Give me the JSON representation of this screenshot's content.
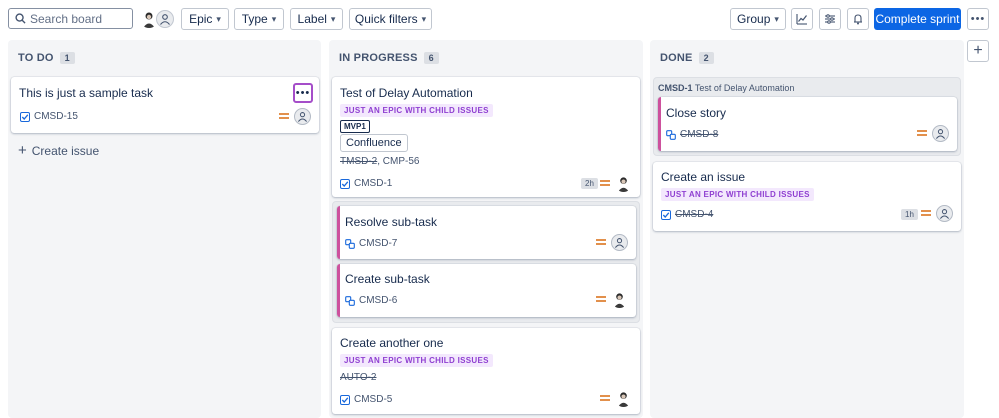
{
  "toolbar": {
    "search_placeholder": "Search board",
    "filters": [
      {
        "label": "Epic"
      },
      {
        "label": "Type"
      },
      {
        "label": "Label"
      },
      {
        "label": "Quick filters"
      }
    ],
    "group_label": "Group",
    "complete_sprint_label": "Complete sprint"
  },
  "columns": [
    {
      "name": "TO DO",
      "count": "1",
      "create_label": "Create issue",
      "cards": [
        {
          "title": "This is just a sample task",
          "key": "CMSD-15"
        }
      ]
    },
    {
      "name": "IN PROGRESS",
      "count": "6",
      "cards": [
        {
          "title": "Test of Delay Automation",
          "epic": "JUST AN EPIC WITH CHILD ISSUES",
          "label_mvp": "MVP1",
          "component": "Confluence",
          "linked_done": "TMSD-2",
          "linked_sep": ",",
          "linked_open": "CMP-56",
          "estimate": "2h",
          "key": "CMSD-1"
        },
        {
          "title": "Resolve sub-task",
          "key": "CMSD-7"
        },
        {
          "title": "Create sub-task",
          "key": "CMSD-6"
        },
        {
          "title": "Create another one",
          "epic": "JUST AN EPIC WITH CHILD ISSUES",
          "linked_done": "AUTO-2",
          "key": "CMSD-5"
        }
      ]
    },
    {
      "name": "DONE",
      "count": "2",
      "parent_key": "CMSD-1",
      "parent_title": "Test of Delay Automation",
      "cards": [
        {
          "title": "Close story",
          "key": "CMSD-8"
        },
        {
          "title": "Create an issue",
          "epic": "JUST AN EPIC WITH CHILD ISSUES",
          "estimate": "1h",
          "key": "CMSD-4"
        }
      ]
    }
  ],
  "colors": {
    "primary": "#0c66e4",
    "epic_bg": "#f3e8fd",
    "epic_text": "#8f3fd1",
    "subtask_bar": "#cd519d",
    "priority_medium": "#e2904c"
  },
  "icons": [
    "search-icon",
    "person-avatar-icon",
    "generic-user-icon",
    "chevron-down-icon",
    "insights-icon",
    "view-settings-icon",
    "automation-icon",
    "more-icon",
    "plus-icon",
    "task-checkbox-icon",
    "subtask-icon",
    "priority-medium-icon"
  ]
}
